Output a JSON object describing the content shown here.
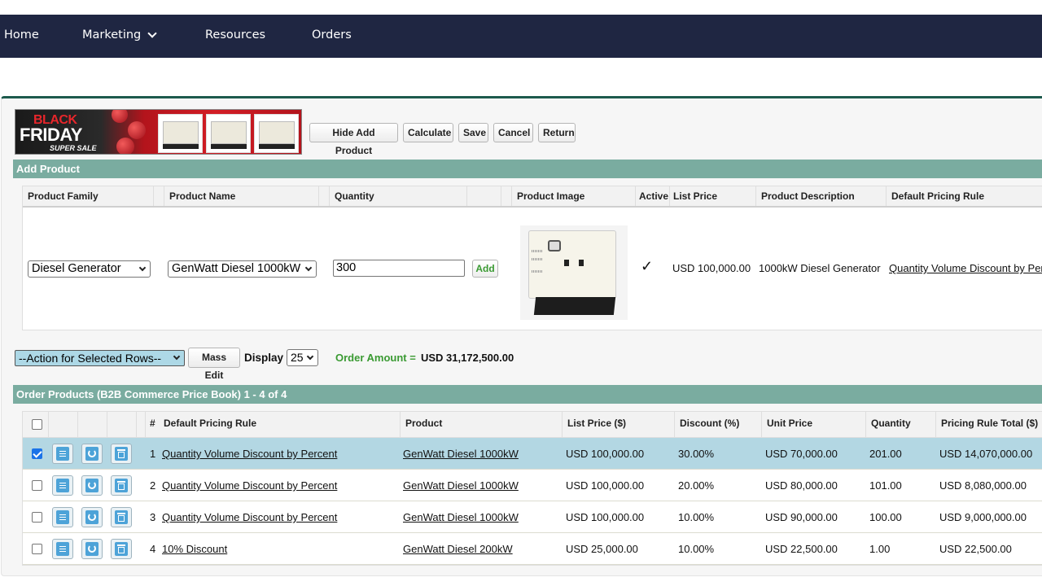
{
  "nav": {
    "items": [
      {
        "label": "Home"
      },
      {
        "label": "Marketing",
        "has_dropdown": true
      },
      {
        "label": "Resources"
      },
      {
        "label": "Orders"
      }
    ]
  },
  "banner": {
    "line1": "BLACK",
    "line2": "FRIDAY",
    "line3": "SUPER SALE"
  },
  "toolbar": {
    "hide_add_product": "Hide Add Product",
    "calculate": "Calculate",
    "save": "Save",
    "cancel": "Cancel",
    "return": "Return"
  },
  "add_product": {
    "title": "Add Product",
    "headers": [
      "Product Family",
      "Product Name",
      "Quantity",
      "Product Image",
      "Active",
      "List Price",
      "Product Description",
      "Default Pricing Rule"
    ],
    "product_family": "Diesel Generator",
    "product_name": "GenWatt Diesel 1000kW",
    "quantity": "300",
    "add_label": "Add",
    "active_mark": "✓",
    "list_price": "USD 100,000.00",
    "description": "1000kW Diesel Generator",
    "pricing_rule": "Quantity Volume Discount by Percent"
  },
  "actions": {
    "action_select": "--Action for Selected Rows--",
    "mass_edit": "Mass Edit",
    "display_label": "Display",
    "display_value": "25",
    "order_amount_label": "Order Amount =",
    "order_amount_value": "USD 31,172,500.00",
    "order_amount_color": "#3a9a32"
  },
  "order_products": {
    "title": "Order Products (B2B Commerce Price Book) 1 - 4 of 4",
    "headers": {
      "num": "#",
      "rule": "Default Pricing Rule",
      "product": "Product",
      "list_price": "List Price ($)",
      "discount": "Discount (%)",
      "unit_price": "Unit Price",
      "quantity": "Quantity",
      "total": "Pricing Rule Total ($)"
    },
    "rows": [
      {
        "checked": true,
        "num": "1",
        "rule": "Quantity Volume Discount by Percent",
        "product": "GenWatt Diesel 1000kW",
        "list_price": "USD 100,000.00",
        "discount": "30.00%",
        "unit_price": "USD 70,000.00",
        "quantity": "201.00",
        "total": "USD 14,070,000.00"
      },
      {
        "checked": false,
        "num": "2",
        "rule": "Quantity Volume Discount by Percent",
        "product": "GenWatt Diesel 1000kW",
        "list_price": "USD 100,000.00",
        "discount": "20.00%",
        "unit_price": "USD 80,000.00",
        "quantity": "101.00",
        "total": "USD 8,080,000.00"
      },
      {
        "checked": false,
        "num": "3",
        "rule": "Quantity Volume Discount by Percent",
        "product": "GenWatt Diesel 1000kW",
        "list_price": "USD 100,000.00",
        "discount": "10.00%",
        "unit_price": "USD 90,000.00",
        "quantity": "100.00",
        "total": "USD 9,000,000.00"
      },
      {
        "checked": false,
        "num": "4",
        "rule": "10% Discount",
        "product": "GenWatt Diesel 200kW",
        "list_price": "USD 25,000.00",
        "discount": "10.00%",
        "unit_price": "USD 22,500.00",
        "quantity": "1.00",
        "total": "USD 22,500.00"
      }
    ]
  }
}
